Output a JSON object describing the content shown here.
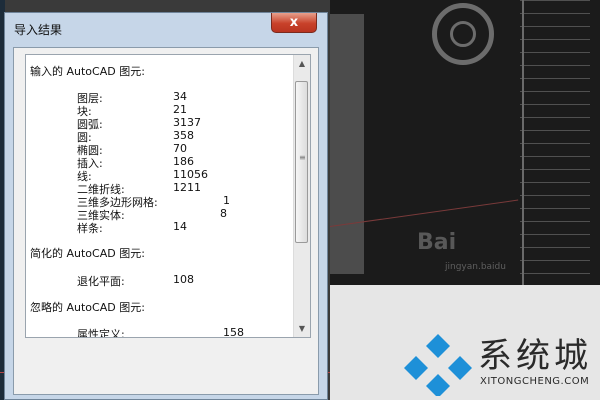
{
  "window": {
    "title": "导入结果",
    "close_glyph": "x"
  },
  "sections": [
    {
      "title": "输入的 AutoCAD 图元:",
      "rows": [
        {
          "label": "图层:",
          "value": "34"
        },
        {
          "label": "块:",
          "value": "21"
        },
        {
          "label": "圆弧:",
          "value": "3137"
        },
        {
          "label": "圆:",
          "value": "358"
        },
        {
          "label": "椭圆:",
          "value": "70"
        },
        {
          "label": "插入:",
          "value": "186"
        },
        {
          "label": "线:",
          "value": "11056"
        },
        {
          "label": "二维折线:",
          "value": "1211"
        },
        {
          "label": "三维多边形网格:",
          "value": "1"
        },
        {
          "label": "三维实体:",
          "value": "8"
        },
        {
          "label": "样条:",
          "value": "14"
        }
      ]
    },
    {
      "title": "简化的 AutoCAD 图元:",
      "rows": [
        {
          "label": "退化平面:",
          "value": "108"
        }
      ]
    },
    {
      "title": "忽略的 AutoCAD 图元:",
      "rows": [
        {
          "label": "属性定义:",
          "value": "158"
        }
      ]
    }
  ],
  "scrollbar": {
    "up_glyph": "▲",
    "down_glyph": "▼",
    "grip_glyph": "≡"
  },
  "background": {
    "watermark": "Bai",
    "watermark_sub": "jingyan.baidu"
  },
  "logo": {
    "text": "系统城",
    "url_text": "XITONGCHENG.COM",
    "colors": {
      "blue": "#1e90d8",
      "text": "#2a2a2a"
    }
  }
}
